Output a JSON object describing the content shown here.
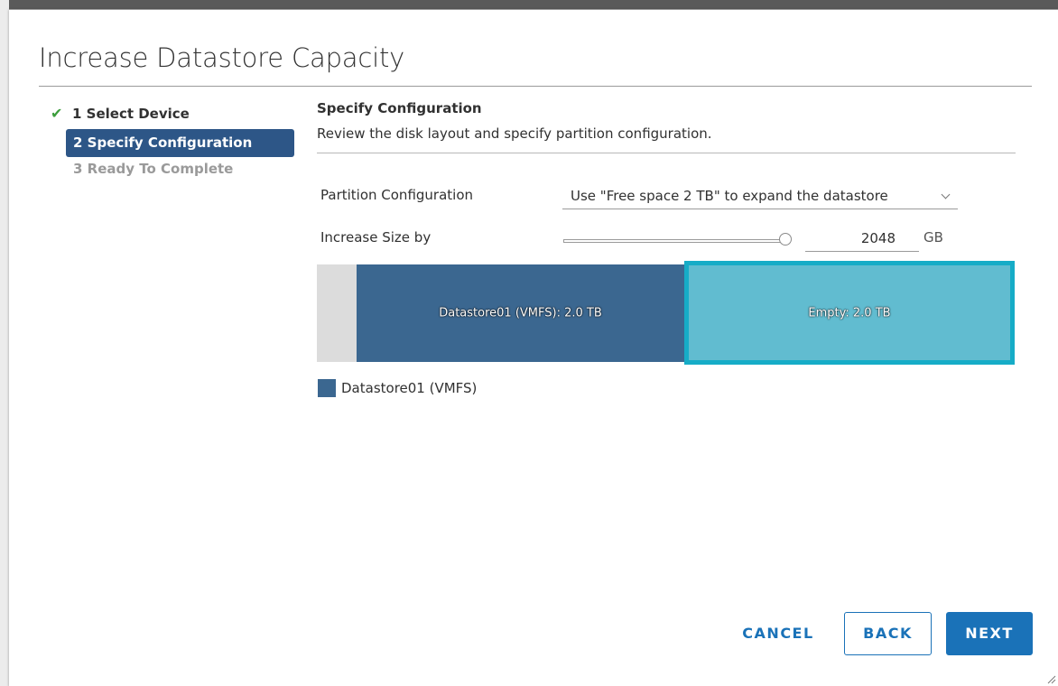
{
  "dialog": {
    "title": "Increase Datastore Capacity"
  },
  "steps": [
    {
      "label": "1 Select Device",
      "state": "complete",
      "icon": "check-icon"
    },
    {
      "label": "2 Specify Configuration",
      "state": "active"
    },
    {
      "label": "3 Ready To Complete",
      "state": "pending"
    }
  ],
  "section": {
    "title": "Specify Configuration",
    "description": "Review the disk layout and specify partition configuration."
  },
  "form": {
    "partition_label": "Partition Configuration",
    "partition_value": "Use \"Free space 2 TB\" to expand the datastore",
    "increase_label": "Increase Size by",
    "increase_value": "2048",
    "increase_unit": "GB",
    "slider_fraction": 1.0
  },
  "disk_layout": {
    "segments": [
      {
        "label": "",
        "color": "#dcdcdc"
      },
      {
        "label": "Datastore01 (VMFS): 2.0 TB",
        "color": "#3b6790"
      },
      {
        "label": "Empty: 2.0 TB",
        "color": "#61bcd0",
        "selected": true
      }
    ],
    "legend": [
      {
        "label": "Datastore01 (VMFS)",
        "color": "#3b6790"
      }
    ]
  },
  "footer": {
    "cancel_label": "CANCEL",
    "back_label": "BACK",
    "next_label": "NEXT"
  },
  "colors": {
    "primary": "#1a72b8",
    "active_step": "#2d5687",
    "selected_border": "#16acc7",
    "check": "#3c9e3c"
  }
}
